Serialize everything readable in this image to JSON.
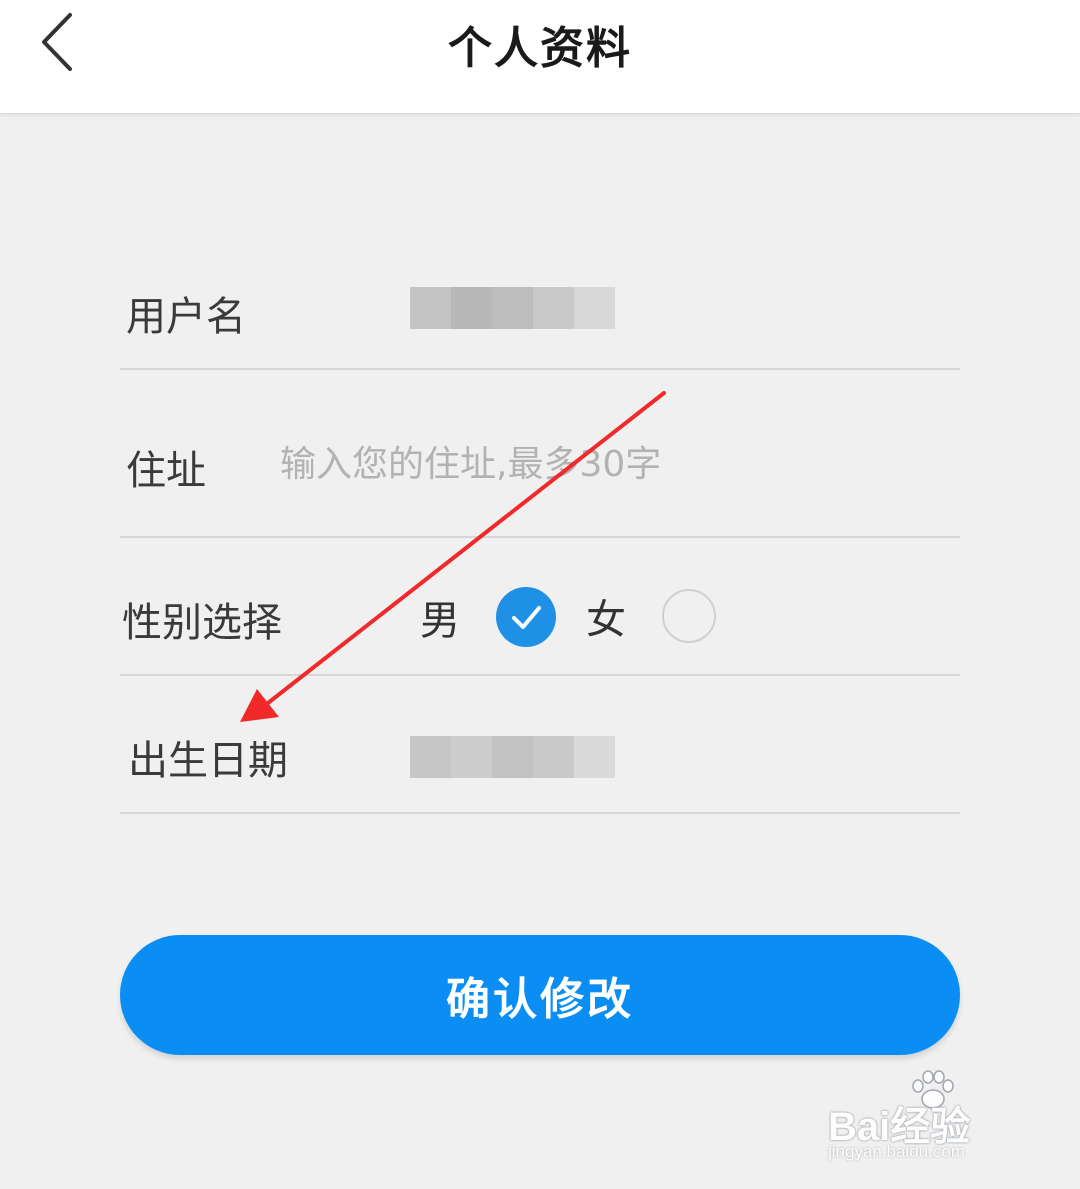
{
  "header": {
    "title": "个人资料"
  },
  "form": {
    "username_label": "用户名",
    "address_label": "住址",
    "address_placeholder": "输入您的住址,最多30字",
    "gender_label": "性别选择",
    "gender_male": "男",
    "gender_female": "女",
    "gender_selected": "男",
    "birthday_label": "出生日期"
  },
  "actions": {
    "confirm_label": "确认修改"
  },
  "watermark": {
    "brand": "Bai经验",
    "url": "jingyan.baidu.com"
  },
  "colors": {
    "accent": "#0b8ef3",
    "checked_radio": "#1e90e6",
    "annotation_arrow": "#f02a2a",
    "background": "#f0f0f0"
  },
  "icons": {
    "back": "chevron-left-icon",
    "check": "checkmark-icon"
  }
}
